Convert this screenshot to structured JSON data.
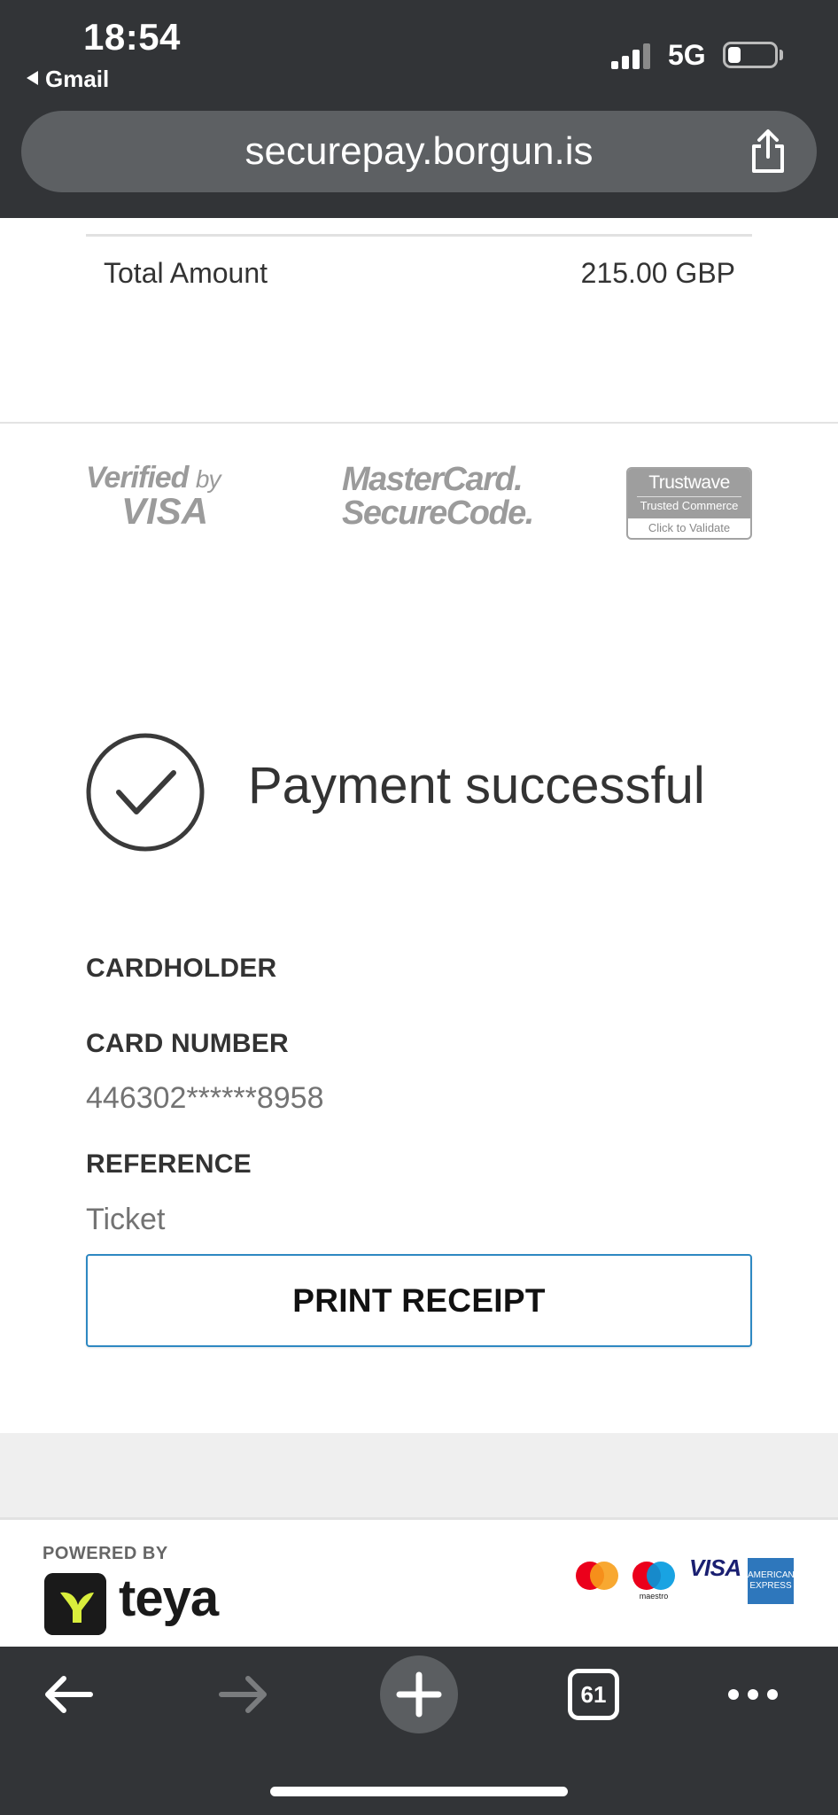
{
  "status_bar": {
    "time": "18:54",
    "back_app": "Gmail",
    "network": "5G"
  },
  "url_bar": {
    "url": "securepay.borgun.is"
  },
  "order_summary": {
    "total_label": "Total Amount",
    "total_value": "215.00 GBP"
  },
  "security_logos": {
    "visa_line1": "Verified",
    "visa_by": "by",
    "visa_line2": "VISA",
    "mc_line1": "MasterCard.",
    "mc_line2": "SecureCode.",
    "trustwave_brand": "Trustwave",
    "trustwave_sub": "Trusted Commerce",
    "trustwave_action": "Click to Validate"
  },
  "result": {
    "title": "Payment successful"
  },
  "details": {
    "cardholder_label": "CARDHOLDER",
    "card_number_label": "CARD NUMBER",
    "card_number_value": "446302******8958",
    "reference_label": "REFERENCE",
    "reference_value": "Ticket"
  },
  "actions": {
    "print_receipt": "PRINT RECEIPT"
  },
  "footer": {
    "powered_by": "POWERED BY",
    "brand": "teya",
    "maestro_caption": "maestro",
    "visa_text": "VISA",
    "amex_line1": "AMERICAN",
    "amex_line2": "EXPRESS"
  },
  "toolbar": {
    "tab_count": "61"
  },
  "colors": {
    "chrome_bg": "#323437",
    "url_pill": "#5d6063",
    "button_border": "#2e88c2",
    "grey_band": "#efefef"
  },
  "icons": {
    "share": "share-icon",
    "success": "check-circle-icon",
    "back": "arrow-left-icon",
    "forward": "arrow-right-icon",
    "new_tab": "plus-icon",
    "tabs": "tabs-icon",
    "more": "ellipsis-icon"
  }
}
